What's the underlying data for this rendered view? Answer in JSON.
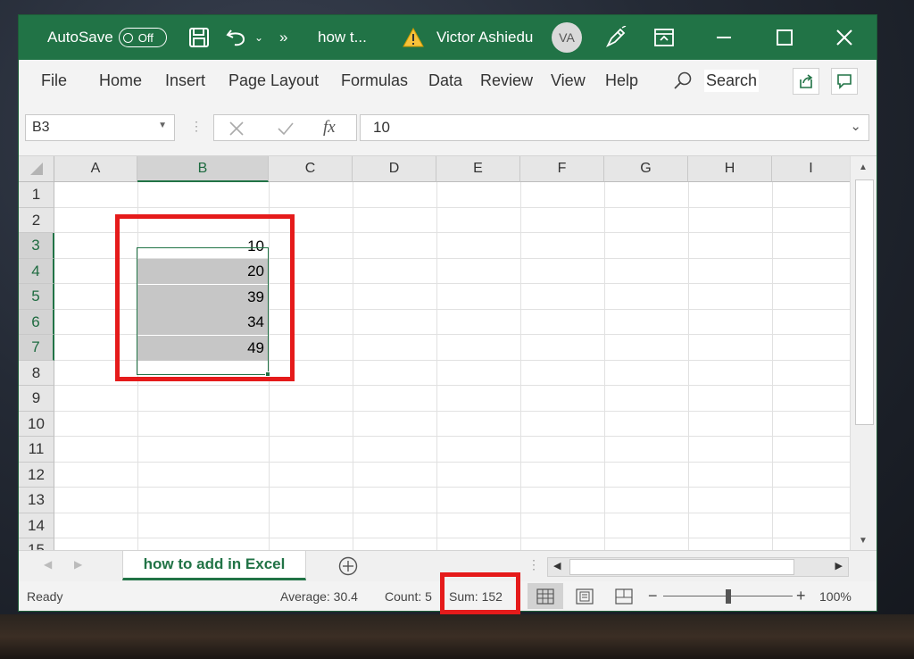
{
  "titlebar": {
    "autosave_label": "AutoSave",
    "autosave_state": "Off",
    "more": "»",
    "doc_title": "how t...",
    "user_name": "Victor Ashiedu",
    "user_initials": "VA"
  },
  "ribbon": {
    "tabs": [
      "File",
      "Home",
      "Insert",
      "Page Layout",
      "Formulas",
      "Data",
      "Review",
      "View",
      "Help"
    ],
    "search_label": "Search"
  },
  "formula_bar": {
    "name_box": "B3",
    "fx_label": "fx",
    "value": "10"
  },
  "grid": {
    "columns": [
      "A",
      "B",
      "C",
      "D",
      "E",
      "F",
      "G",
      "H",
      "I"
    ],
    "rows": [
      "1",
      "2",
      "3",
      "4",
      "5",
      "6",
      "7",
      "8",
      "9",
      "10",
      "11",
      "12",
      "13",
      "14",
      "15"
    ],
    "selected_column": "B",
    "selected_rows": [
      "3",
      "4",
      "5",
      "6",
      "7"
    ],
    "cells_B": [
      "10",
      "20",
      "39",
      "34",
      "49"
    ]
  },
  "sheets": {
    "tabs": [
      "how to add in Excel"
    ]
  },
  "status": {
    "ready": "Ready",
    "average": "Average: 30.4",
    "count": "Count: 5",
    "sum": "Sum: 152",
    "zoom": "100%",
    "zoom_minus": "−",
    "zoom_plus": "+"
  },
  "colors": {
    "excel_green": "#217346",
    "highlight_red": "#e51b1b",
    "selection_fill": "#c6c6c6"
  }
}
